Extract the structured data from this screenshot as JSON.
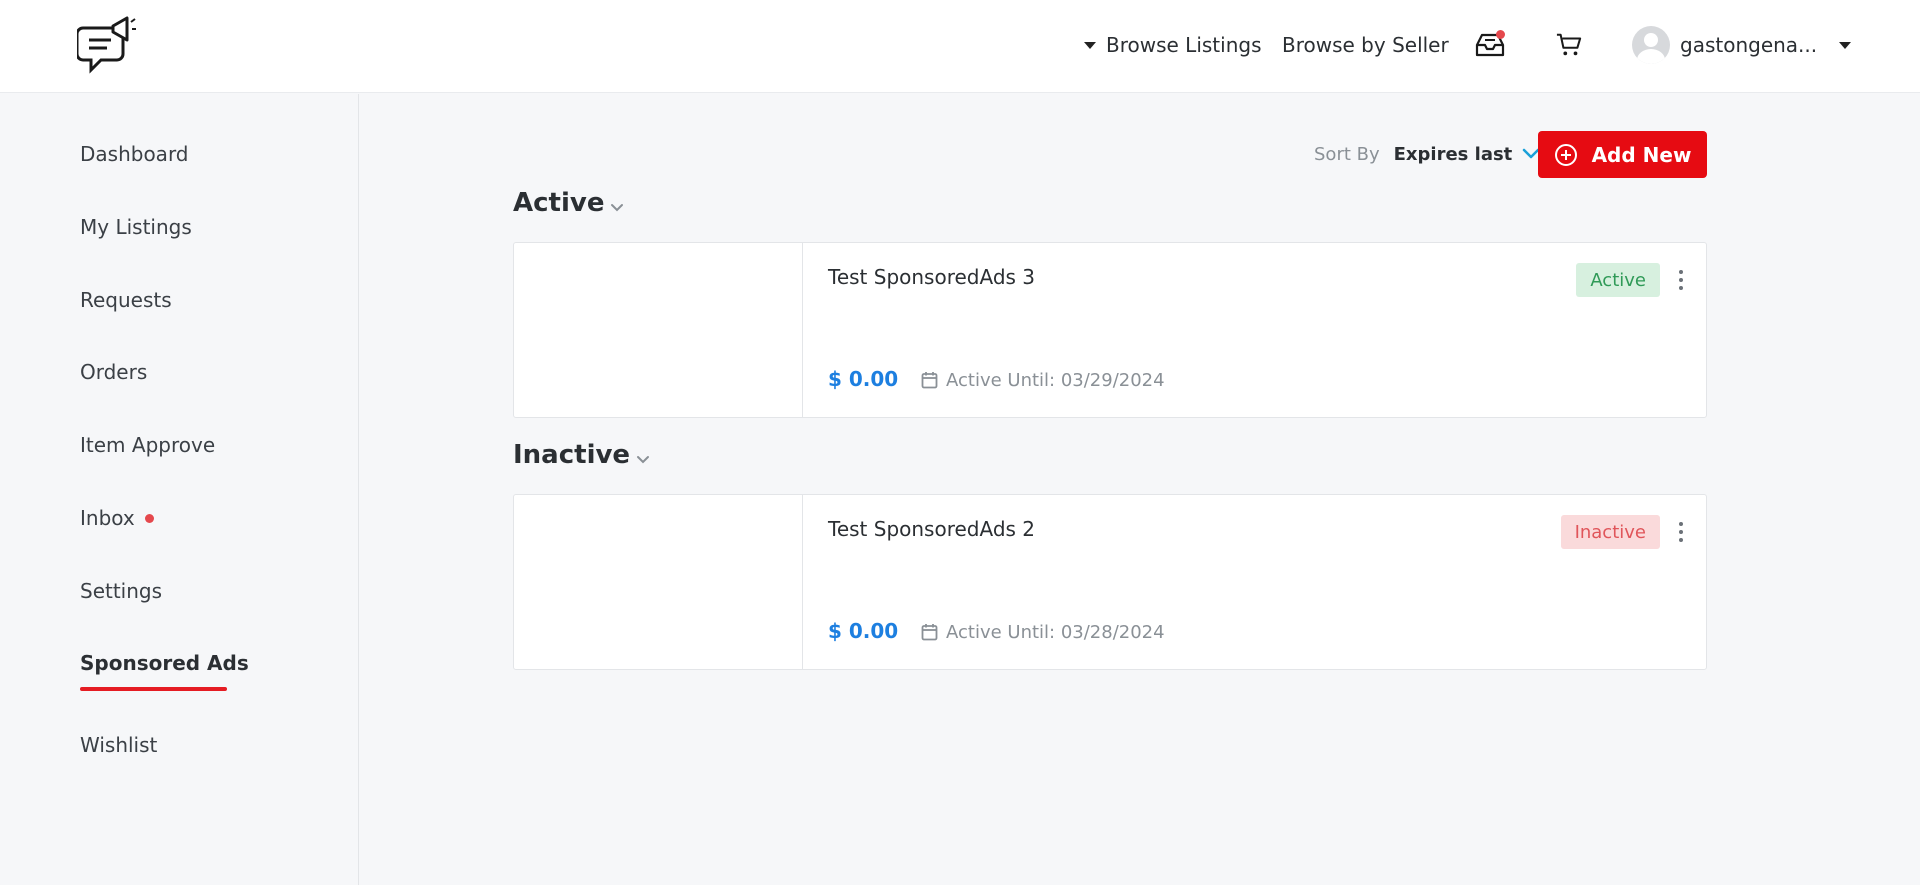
{
  "header": {
    "browse_listings": "Browse Listings",
    "browse_by_seller": "Browse by Seller",
    "username": "gastongena..."
  },
  "sidebar": {
    "items": [
      {
        "label": "Dashboard"
      },
      {
        "label": "My Listings"
      },
      {
        "label": "Requests"
      },
      {
        "label": "Orders"
      },
      {
        "label": "Item Approve"
      },
      {
        "label": "Inbox"
      },
      {
        "label": "Settings"
      },
      {
        "label": "Sponsored Ads",
        "active": true
      },
      {
        "label": "Wishlist"
      }
    ]
  },
  "toolbar": {
    "sort_label": "Sort By",
    "sort_value": "Expires last",
    "add_new": "Add New"
  },
  "sections": [
    {
      "title": "Active",
      "cards": [
        {
          "title": "Test SponsoredAds 3",
          "price": "$ 0.00",
          "active_until": "Active Until: 03/29/2024",
          "status": "Active"
        }
      ]
    },
    {
      "title": "Inactive",
      "cards": [
        {
          "title": "Test SponsoredAds 2",
          "price": "$ 0.00",
          "active_until": "Active Until: 03/28/2024",
          "status": "Inactive"
        }
      ]
    }
  ],
  "colors": {
    "accent_red": "#e60b12",
    "price_blue": "#1d7fe0",
    "active_green": "#2f9a57",
    "inactive_red": "#e0555a"
  },
  "icons": {
    "logo": "chat-megaphone-logo",
    "inbox": "inbox-tray-icon",
    "cart": "cart-icon",
    "calendar": "calendar-icon",
    "add": "plus-circle-icon"
  }
}
